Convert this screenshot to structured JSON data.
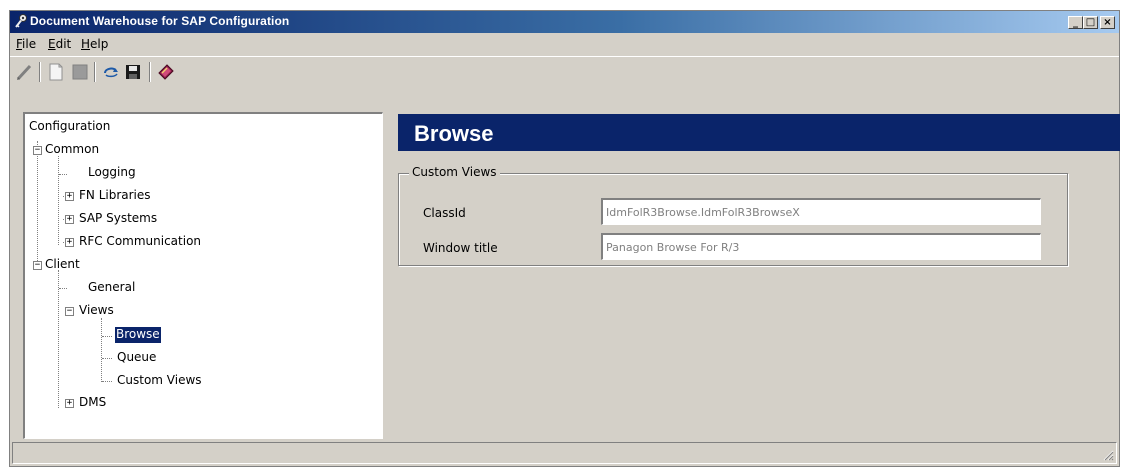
{
  "window": {
    "title": "Document Warehouse for SAP Configuration",
    "controls": {
      "minimize": "_",
      "maximize": "□",
      "close": "×"
    }
  },
  "menu": {
    "items": [
      {
        "label": "File",
        "mnemonic": "F"
      },
      {
        "label": "Edit",
        "mnemonic": "E"
      },
      {
        "label": "Help",
        "mnemonic": "H"
      }
    ]
  },
  "toolbar": {
    "icons": [
      "pencil-icon",
      "new-document-icon",
      "gray-block-icon",
      "refresh-icon",
      "save-icon",
      "book-icon"
    ]
  },
  "tree": {
    "nodes": [
      {
        "label": "Configuration"
      },
      {
        "label": "Common"
      },
      {
        "label": "Logging"
      },
      {
        "label": "FN Libraries"
      },
      {
        "label": "SAP Systems"
      },
      {
        "label": "RFC Communication"
      },
      {
        "label": "Client"
      },
      {
        "label": "General"
      },
      {
        "label": "Views"
      },
      {
        "label": "Browse"
      },
      {
        "label": "Queue"
      },
      {
        "label": "Custom Views"
      },
      {
        "label": "DMS"
      }
    ],
    "selected": "Browse"
  },
  "panel": {
    "title": "Browse",
    "group_label": "Custom Views",
    "fields": [
      {
        "label": "ClassId",
        "value": "IdmFolR3Browse.IdmFolR3BrowseX"
      },
      {
        "label": "Window title",
        "value": "Panagon Browse For R/3"
      }
    ]
  },
  "colors": {
    "title_bar": "#0a246a",
    "header_banner": "#0a246a",
    "window_face": "#d4d0c8",
    "selection": "#0a246a"
  }
}
